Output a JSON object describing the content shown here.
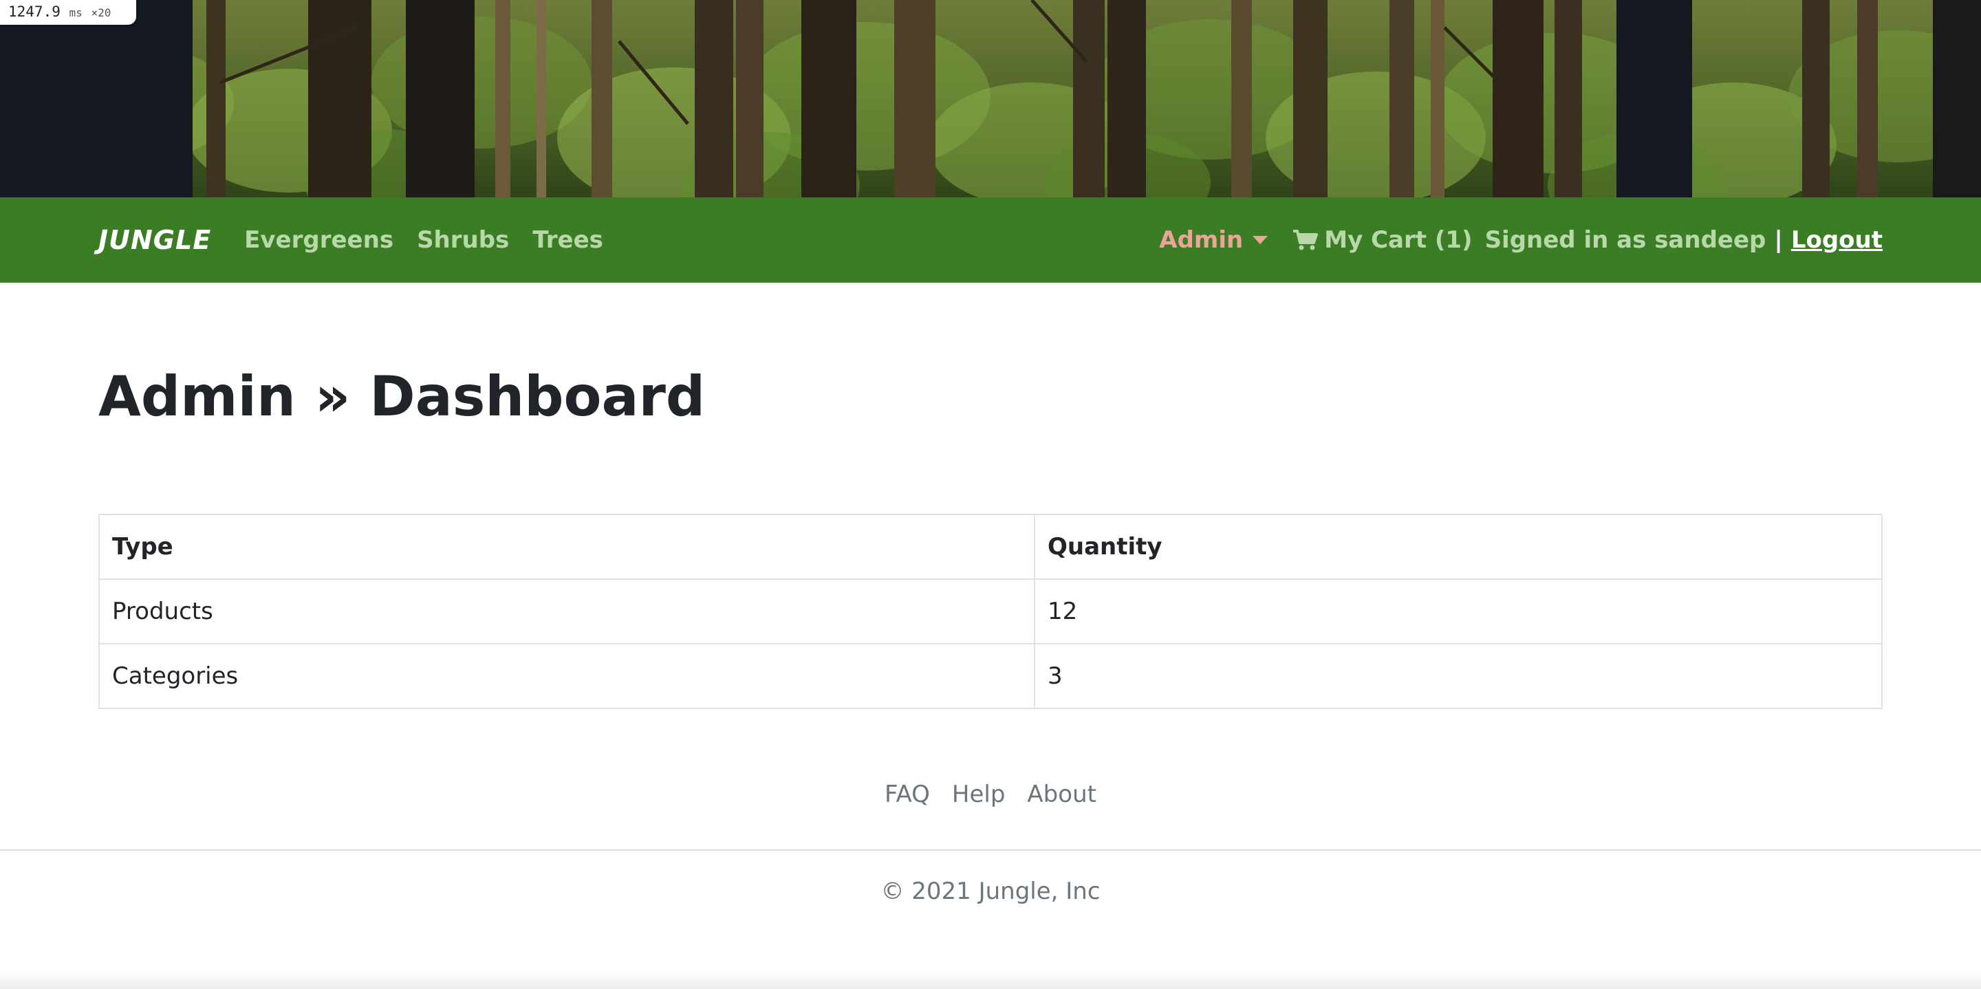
{
  "timing": {
    "value": "1247.9",
    "unit": "ms",
    "multiplier": "×20"
  },
  "navbar": {
    "brand": "JUNGLE",
    "links": [
      "Evergreens",
      "Shrubs",
      "Trees"
    ],
    "admin_label": "Admin",
    "cart_label": "My Cart (1)",
    "signed_in": "Signed in as sandeep",
    "separator": "|",
    "logout": "Logout",
    "colors": {
      "bar": "#3a7d24",
      "link": "#b9d8aa",
      "admin": "#eea39a",
      "brand": "#ffffff"
    }
  },
  "banner": {
    "image": "forest-trees-photo"
  },
  "page": {
    "title": "Admin » Dashboard"
  },
  "table": {
    "headers": [
      "Type",
      "Quantity"
    ],
    "rows": [
      [
        "Products",
        "12"
      ],
      [
        "Categories",
        "3"
      ]
    ]
  },
  "footer": {
    "links": [
      "FAQ",
      "Help",
      "About"
    ],
    "copyright": "© 2021 Jungle, Inc"
  }
}
